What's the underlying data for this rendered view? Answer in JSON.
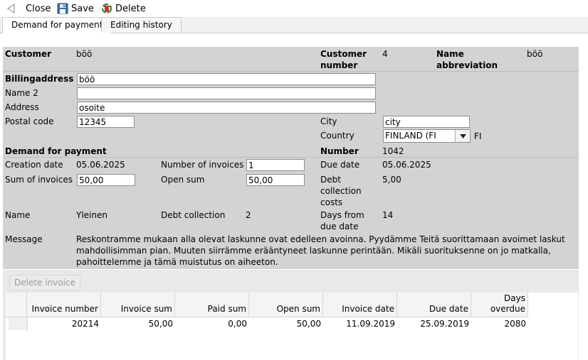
{
  "toolbar": {
    "close_label": "Close",
    "save_label": "Save",
    "delete_label": "Delete",
    "close_icon": "triangle-left-icon",
    "save_icon": "floppy-disk-icon",
    "delete_icon": "recycle-delete-icon"
  },
  "tabs": [
    {
      "label": "Demand for payment",
      "active": true
    },
    {
      "label": "Editing history",
      "active": false
    }
  ],
  "customer": {
    "customer_label": "Customer",
    "customer_value": "böö",
    "number_label_line1": "Customer",
    "number_label_line2": "number",
    "number_value": "4",
    "abbr_label_line1": "Name",
    "abbr_label_line2": "abbreviation",
    "abbr_value": "böö"
  },
  "billing": {
    "billing_label": "Billingaddress",
    "billing_value": "böö",
    "name2_label": "Name 2",
    "name2_value": "",
    "address_label": "Address",
    "address_value": "osoite",
    "postal_label": "Postal code",
    "postal_value": "12345",
    "city_label": "City",
    "city_value": "city",
    "country_label": "Country",
    "country_value": "FINLAND (FI",
    "country_code": "FI"
  },
  "demand": {
    "section_label": "Demand for payment",
    "number_label": "Number",
    "number_value": "1042",
    "creation_label": "Creation date",
    "creation_value": "05.06.2025",
    "num_invoices_label": "Number of invoices",
    "num_invoices_value": "1",
    "due_label": "Due date",
    "due_value": "05.06.2025",
    "sum_label": "Sum of invoices",
    "sum_value": "50,00",
    "open_label": "Open sum",
    "open_value": "50,00",
    "costs_label_line1": "Debt",
    "costs_label_line2": "collection",
    "costs_label_line3": "costs",
    "costs_value": "5,00",
    "name_label": "Name",
    "name_value": "Yleinen",
    "debt_coll_label": "Debt collection",
    "debt_coll_value": "2",
    "days_label_line1": "Days from",
    "days_label_line2": "due date",
    "days_value": "14",
    "message_label": "Message",
    "message_line1": "Reskontramme mukaan alla olevat laskunne ovat edelleen avoinna. Pyydämme Teitä suorittamaan avoimet laskut",
    "message_line2": "mahdollisimman pian. Muuten siirrämme erääntyneet laskunne perintään. Mikäli suorituksenne on jo matkalla,",
    "message_line3": "pahoittelemme ja tämä muistutus on aiheeton."
  },
  "grid": {
    "delete_invoice_label": "Delete invoice",
    "headers": {
      "invoice_number": "Invoice number",
      "invoice_sum": "Invoice sum",
      "paid_sum": "Paid sum",
      "open_sum": "Open sum",
      "invoice_date": "Invoice date",
      "due_date": "Due date",
      "days_overdue_line1": "Days",
      "days_overdue_line2": "overdue"
    },
    "rows": [
      {
        "invoice_number": "20214",
        "invoice_sum": "50,00",
        "paid_sum": "0,00",
        "open_sum": "50,00",
        "invoice_date": "11.09.2019",
        "due_date": "25.09.2019",
        "days_overdue": "2080"
      }
    ]
  }
}
